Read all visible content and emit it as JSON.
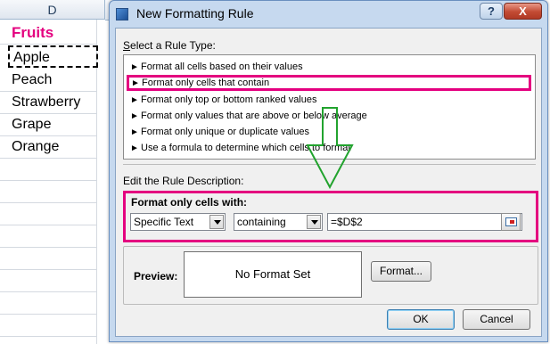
{
  "sheet": {
    "column_letter": "D",
    "cells": [
      "Fruits",
      "Apple",
      "Peach",
      "Strawberry",
      "Grape",
      "Orange"
    ]
  },
  "dialog": {
    "title": "New Formatting Rule",
    "help_label": "?",
    "close_label": "X",
    "select_rule_type_label": "Select a Rule Type:",
    "rule_types": [
      "Format all cells based on their values",
      "Format only cells that contain",
      "Format only top or bottom ranked values",
      "Format only values that are above or below average",
      "Format only unique or duplicate values",
      "Use a formula to determine which cells to format"
    ],
    "selected_rule_index": 1,
    "edit_description_label": "Edit the Rule Description:",
    "format_only_cells_with": "Format only cells with:",
    "condition_type": "Specific Text",
    "operator": "containing",
    "reference_value": "=$D$2",
    "preview_label": "Preview:",
    "preview_text": "No Format Set",
    "format_button": "Format...",
    "ok_button": "OK",
    "cancel_button": "Cancel"
  },
  "colors": {
    "highlight": "#e4007f",
    "arrow": "#22a32e"
  }
}
